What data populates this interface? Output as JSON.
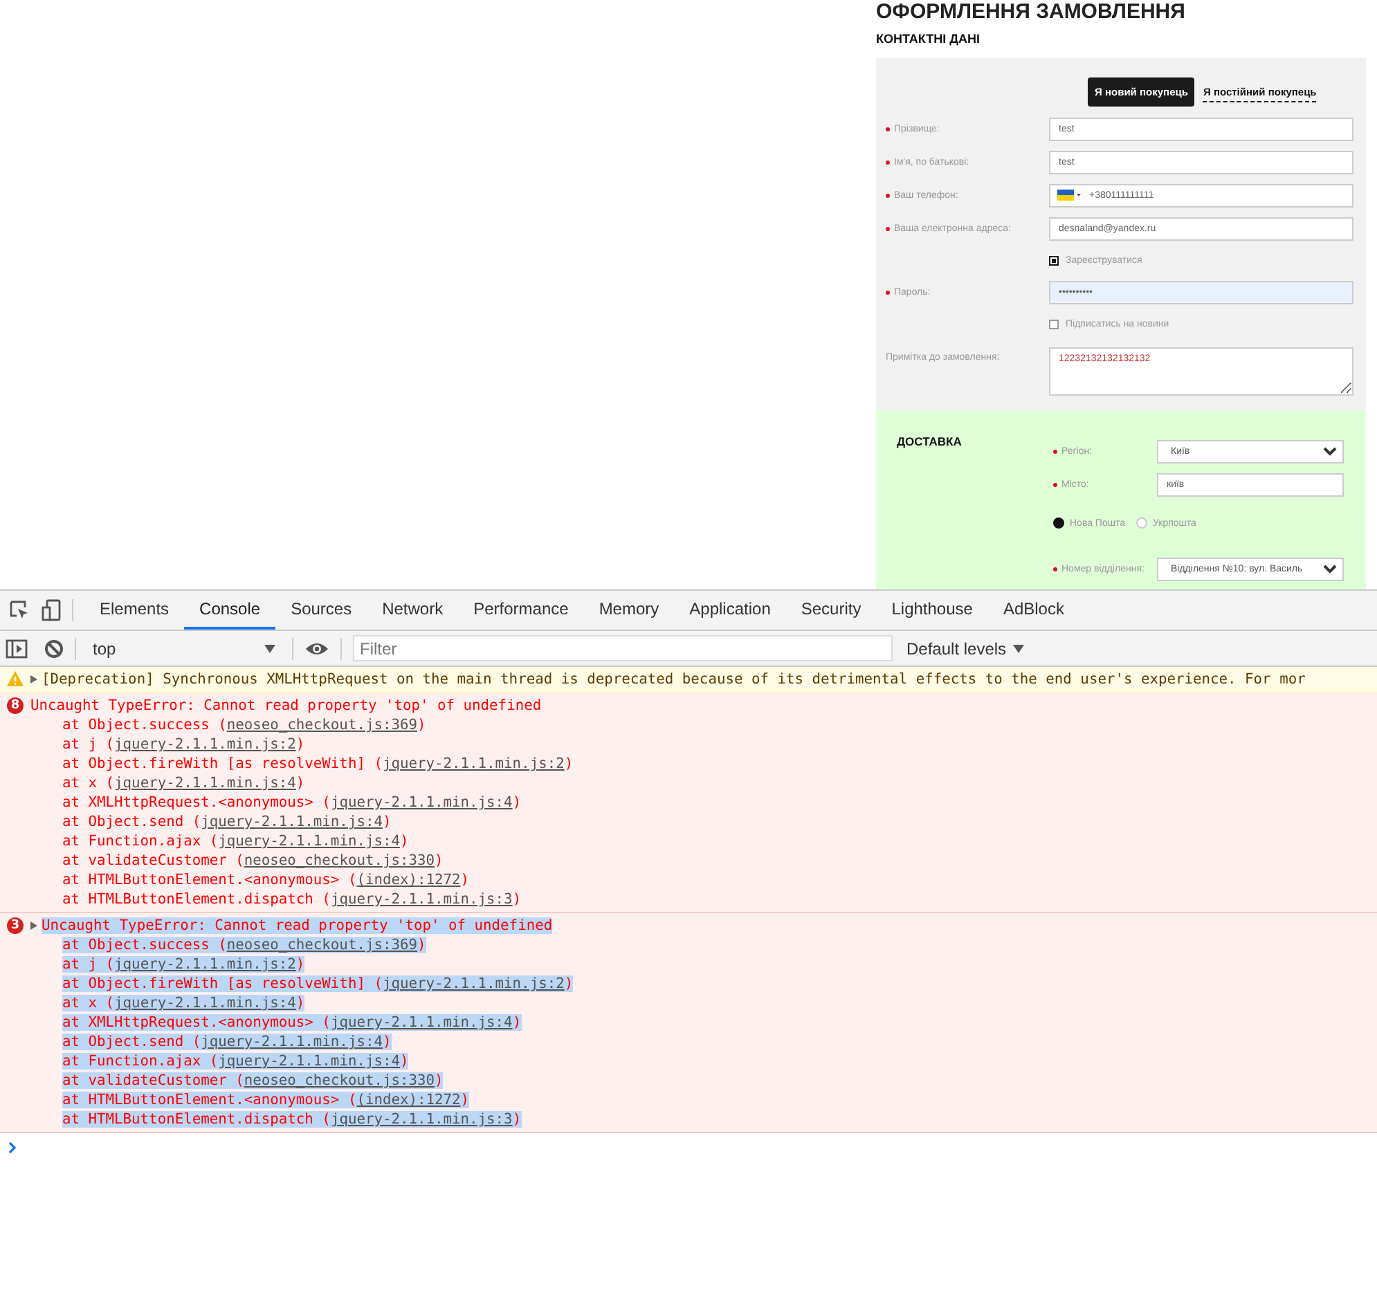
{
  "page": {
    "heading": "ОФОРМЛЕННЯ ЗАМОВЛЕННЯ",
    "contact": {
      "title": "КОНТАКТНІ ДАНІ",
      "customer_tabs": [
        {
          "label": "Я новий покупець",
          "selected": true
        },
        {
          "label": "Я постійний покупець",
          "selected": false
        }
      ],
      "fields": [
        {
          "kind": "text",
          "label": "Прізвище:",
          "required": true,
          "value": "test"
        },
        {
          "kind": "text",
          "label": "Ім'я, по батькові:",
          "required": true,
          "value": "test"
        },
        {
          "kind": "phone",
          "label": "Ваш телефон:",
          "required": true,
          "value": "+380111111111"
        },
        {
          "kind": "text",
          "label": "Ваша електронна адреса:",
          "required": true,
          "value": "desnaland@yandex.ru"
        },
        {
          "kind": "checkbox",
          "label": "Зареєструватися",
          "checked": true
        },
        {
          "kind": "password",
          "label": "Пароль:",
          "required": true,
          "value": "••••••••••"
        },
        {
          "kind": "checkbox",
          "label": "Підписатись на новини",
          "checked": false
        },
        {
          "kind": "textarea",
          "label": "Примітка до замовлення:",
          "required": false,
          "value": "12232132132132132"
        }
      ]
    },
    "delivery": {
      "title": "ДОСТАВКА",
      "fields": [
        {
          "kind": "select",
          "label": "Регіон:",
          "required": true,
          "value": "Київ"
        },
        {
          "kind": "text",
          "label": "Місто:",
          "required": true,
          "value": "київ"
        },
        {
          "kind": "radio",
          "options": [
            {
              "label": "Нова Пошта",
              "selected": true
            },
            {
              "label": "Укрпошта",
              "selected": false
            }
          ]
        },
        {
          "kind": "select",
          "label": "Номер відділення:",
          "required": true,
          "value": "Відділення №10: вул. Василь"
        }
      ]
    }
  },
  "devtools": {
    "tabs": [
      {
        "label": "Elements",
        "selected": false
      },
      {
        "label": "Console",
        "selected": true
      },
      {
        "label": "Sources",
        "selected": false
      },
      {
        "label": "Network",
        "selected": false
      },
      {
        "label": "Performance",
        "selected": false
      },
      {
        "label": "Memory",
        "selected": false
      },
      {
        "label": "Application",
        "selected": false
      },
      {
        "label": "Security",
        "selected": false
      },
      {
        "label": "Lighthouse",
        "selected": false
      },
      {
        "label": "AdBlock",
        "selected": false
      }
    ],
    "context": "top",
    "filter": {
      "placeholder": "Filter"
    },
    "levels": "Default levels",
    "messages": [
      {
        "kind": "warning",
        "collapsible": true,
        "selected": false,
        "text": "[Deprecation] Synchronous XMLHttpRequest on the main thread is deprecated because of its detrimental effects to the end user's experience. For mor"
      },
      {
        "kind": "error",
        "count": "8",
        "collapsible": false,
        "selected": false,
        "text": "Uncaught TypeError: Cannot read property 'top' of undefined",
        "frames": [
          {
            "call": "at Object.success (",
            "source": "neoseo_checkout.js:369",
            "after": ")"
          },
          {
            "call": "at j (",
            "source": "jquery-2.1.1.min.js:2",
            "after": ")"
          },
          {
            "call": "at Object.fireWith [as resolveWith] (",
            "source": "jquery-2.1.1.min.js:2",
            "after": ")"
          },
          {
            "call": "at x (",
            "source": "jquery-2.1.1.min.js:4",
            "after": ")"
          },
          {
            "call": "at XMLHttpRequest.<anonymous> (",
            "source": "jquery-2.1.1.min.js:4",
            "after": ")"
          },
          {
            "call": "at Object.send (",
            "source": "jquery-2.1.1.min.js:4",
            "after": ")"
          },
          {
            "call": "at Function.ajax (",
            "source": "jquery-2.1.1.min.js:4",
            "after": ")"
          },
          {
            "call": "at validateCustomer (",
            "source": "neoseo_checkout.js:330",
            "after": ")"
          },
          {
            "call": "at HTMLButtonElement.<anonymous> (",
            "source": "(index):1272",
            "after": ")"
          },
          {
            "call": "at HTMLButtonElement.dispatch (",
            "source": "jquery-2.1.1.min.js:3",
            "after": ")"
          }
        ]
      },
      {
        "kind": "error",
        "count": "3",
        "collapsible": true,
        "selected": true,
        "text": "Uncaught TypeError: Cannot read property 'top' of undefined",
        "frames": [
          {
            "call": "at Object.success (",
            "source": "neoseo_checkout.js:369",
            "after": ")"
          },
          {
            "call": "at j (",
            "source": "jquery-2.1.1.min.js:2",
            "after": ")"
          },
          {
            "call": "at Object.fireWith [as resolveWith] (",
            "source": "jquery-2.1.1.min.js:2",
            "after": ")"
          },
          {
            "call": "at x (",
            "source": "jquery-2.1.1.min.js:4",
            "after": ")"
          },
          {
            "call": "at XMLHttpRequest.<anonymous> (",
            "source": "jquery-2.1.1.min.js:4",
            "after": ")"
          },
          {
            "call": "at Object.send (",
            "source": "jquery-2.1.1.min.js:4",
            "after": ")"
          },
          {
            "call": "at Function.ajax (",
            "source": "jquery-2.1.1.min.js:4",
            "after": ")"
          },
          {
            "call": "at validateCustomer (",
            "source": "neoseo_checkout.js:330",
            "after": ")"
          },
          {
            "call": "at HTMLButtonElement.<anonymous> (",
            "source": "(index):1272",
            "after": ")"
          },
          {
            "call": "at HTMLButtonElement.dispatch (",
            "source": "jquery-2.1.1.min.js:3",
            "after": ")"
          }
        ]
      }
    ]
  }
}
